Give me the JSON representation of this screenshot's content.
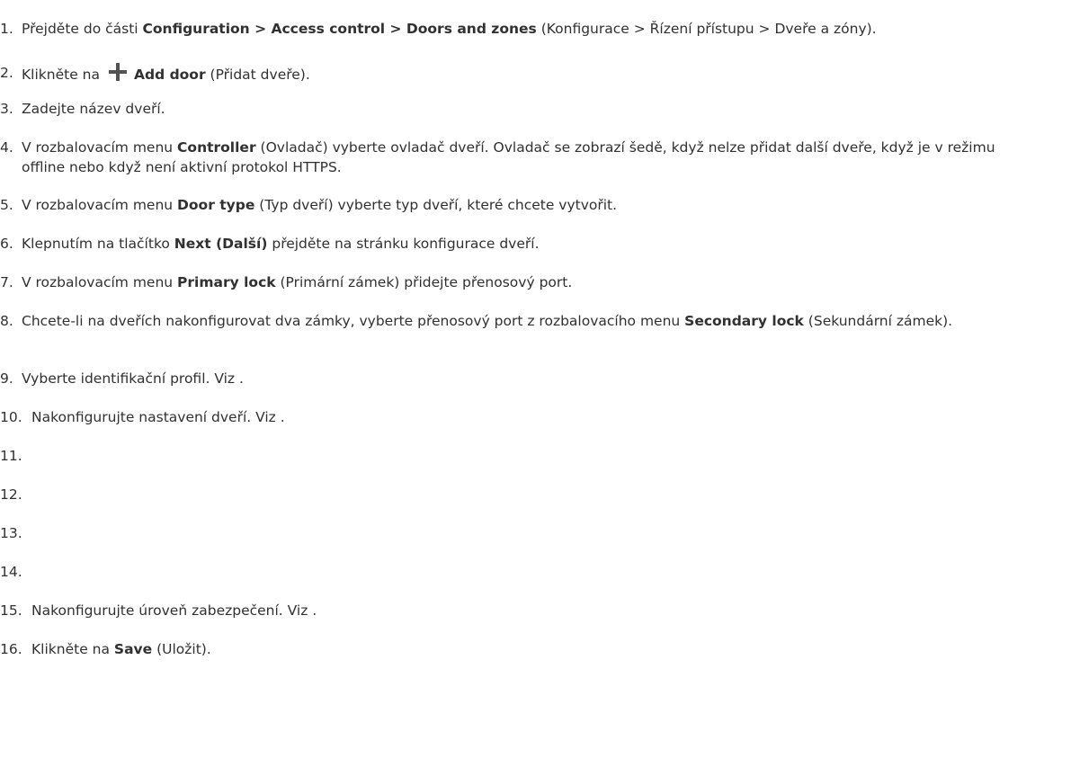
{
  "steps": [
    {
      "number": "1.",
      "parts": [
        {
          "t": "Přejděte do části ",
          "b": false
        },
        {
          "t": "Configuration > Access control > Doors and zones",
          "b": true
        },
        {
          "t": " (Konfigurace > Řízení přístupu > Dveře a zóny).",
          "b": false
        }
      ]
    },
    {
      "number": "2.",
      "icon": "plus-icon",
      "parts": [
        {
          "t": "Klikněte na",
          "b": false
        },
        {
          "icon": true
        },
        {
          "t": "Add door",
          "b": true
        },
        {
          "t": " (Přidat dveře).",
          "b": false
        }
      ]
    },
    {
      "number": "3.",
      "parts": [
        {
          "t": "Zadejte název dveří.",
          "b": false
        }
      ]
    },
    {
      "number": "4.",
      "parts": [
        {
          "t": "V rozbalovacím menu ",
          "b": false
        },
        {
          "t": "Controller",
          "b": true
        },
        {
          "t": " (Ovladač) vyberte ovladač dveří. Ovladač se zobrazí šedě, když nelze přidat další dveře, když je v režimu offline nebo když není aktivní protokol HTTPS.",
          "b": false
        }
      ]
    },
    {
      "number": "5.",
      "parts": [
        {
          "t": "V rozbalovacím menu ",
          "b": false
        },
        {
          "t": "Door type",
          "b": true
        },
        {
          "t": " (Typ dveří) vyberte typ dveří, které chcete vytvořit.",
          "b": false
        }
      ]
    },
    {
      "number": "6.",
      "parts": [
        {
          "t": "Klepnutím na tlačítko ",
          "b": false
        },
        {
          "t": "Next (Další)",
          "b": true
        },
        {
          "t": " přejděte na stránku konfigurace dveří.",
          "b": false
        }
      ]
    },
    {
      "number": "7.",
      "parts": [
        {
          "t": "V rozbalovacím menu ",
          "b": false
        },
        {
          "t": "Primary lock",
          "b": true
        },
        {
          "t": " (Primární zámek) přidejte přenosový port.",
          "b": false
        }
      ]
    },
    {
      "number": "8.",
      "parts": [
        {
          "t": "Chcete-li na dveřích nakonfigurovat dva zámky, vyberte přenosový port z rozbalovacího menu ",
          "b": false
        },
        {
          "t": "Secondary lock",
          "b": true
        },
        {
          "t": " (Sekundární zámek).",
          "b": false
        }
      ]
    },
    {
      "number": "9.",
      "parts": [
        {
          "t": "Vyberte identifikační profil. Viz .",
          "b": false
        }
      ]
    },
    {
      "number": "10.",
      "parts": [
        {
          "t": "Nakonfigurujte nastavení dveří. Viz .",
          "b": false
        }
      ]
    },
    {
      "number": "11.",
      "parts": []
    },
    {
      "number": "12.",
      "parts": []
    },
    {
      "number": "13.",
      "parts": []
    },
    {
      "number": "14.",
      "parts": []
    },
    {
      "number": "15.",
      "parts": [
        {
          "t": "Nakonfigurujte úroveň zabezpečení. Viz .",
          "b": false
        }
      ]
    },
    {
      "number": "16.",
      "parts": [
        {
          "t": "Klikněte na ",
          "b": false
        },
        {
          "t": "Save",
          "b": true
        },
        {
          "t": " (Uložit).",
          "b": false
        }
      ]
    }
  ]
}
